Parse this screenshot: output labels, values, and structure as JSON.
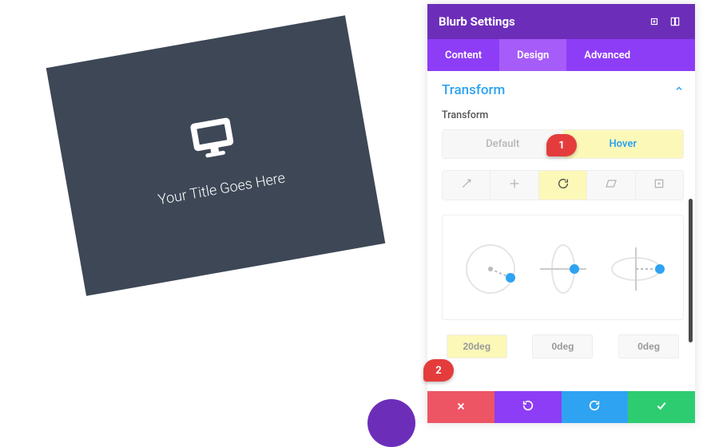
{
  "canvas": {
    "blurb_title": "Your Title Goes Here"
  },
  "panel": {
    "header_title": "Blurb Settings",
    "tabs": {
      "content": "Content",
      "design": "Design",
      "advanced": "Advanced",
      "active": "design"
    },
    "section": {
      "title": "Transform",
      "sub_label": "Transform"
    },
    "state_toggle": {
      "default": "Default",
      "hover": "Hover"
    },
    "rotation_values": {
      "z": "20deg",
      "x": "0deg",
      "y": "0deg"
    }
  },
  "callouts": {
    "one": "1",
    "two": "2"
  },
  "colors": {
    "panel_header": "#6c2eb9",
    "tabs_bg": "#8e3df6",
    "accent_blue": "#2ea3f2",
    "highlight": "#fcf8b8",
    "blurb_bg": "#3d4756",
    "cancel": "#ed5565",
    "save": "#2ecc71"
  }
}
